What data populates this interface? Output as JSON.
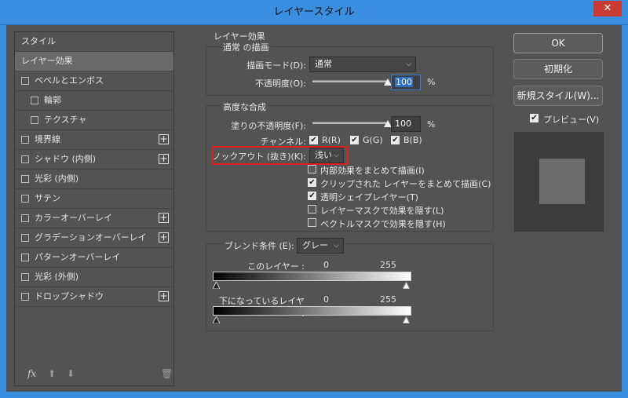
{
  "window": {
    "title": "レイヤースタイル",
    "close_glyph": "✕"
  },
  "style_list": {
    "items": [
      {
        "label": "スタイル",
        "checkbox": false,
        "plus": false,
        "active": false,
        "indent": 0
      },
      {
        "label": "レイヤー効果",
        "checkbox": false,
        "plus": false,
        "active": true,
        "indent": 0
      },
      {
        "label": "ベベルとエンボス",
        "checkbox": true,
        "plus": false,
        "active": false,
        "indent": 0
      },
      {
        "label": "輪郭",
        "checkbox": true,
        "plus": false,
        "active": false,
        "indent": 1
      },
      {
        "label": "テクスチャ",
        "checkbox": true,
        "plus": false,
        "active": false,
        "indent": 1
      },
      {
        "label": "境界線",
        "checkbox": true,
        "plus": true,
        "active": false,
        "indent": 0
      },
      {
        "label": "シャドウ (内側)",
        "checkbox": true,
        "plus": true,
        "active": false,
        "indent": 0
      },
      {
        "label": "光彩 (内側)",
        "checkbox": true,
        "plus": false,
        "active": false,
        "indent": 0
      },
      {
        "label": "サテン",
        "checkbox": true,
        "plus": false,
        "active": false,
        "indent": 0
      },
      {
        "label": "カラーオーバーレイ",
        "checkbox": true,
        "plus": true,
        "active": false,
        "indent": 0
      },
      {
        "label": "グラデーションオーバーレイ",
        "checkbox": true,
        "plus": true,
        "active": false,
        "indent": 0
      },
      {
        "label": "パターンオーバーレイ",
        "checkbox": true,
        "plus": false,
        "active": false,
        "indent": 0
      },
      {
        "label": "光彩 (外側)",
        "checkbox": true,
        "plus": false,
        "active": false,
        "indent": 0
      },
      {
        "label": "ドロップシャドウ",
        "checkbox": true,
        "plus": true,
        "active": false,
        "indent": 0
      }
    ],
    "plus_glyph": "+",
    "bottom_icons": {
      "fx": "fx",
      "up": "⬆",
      "down": "⬇",
      "trash": "🗑"
    }
  },
  "panel": {
    "section_title": "レイヤー効果",
    "normal_group": {
      "title": "通常 の描画",
      "blend_mode_label": "描画モード(D):",
      "blend_mode_value": "通常",
      "opacity_label": "不透明度(O):",
      "opacity_value": "100",
      "opacity_level": 1.0,
      "unit": "%"
    },
    "advanced_group": {
      "title": "高度な合成",
      "fill_opacity_label": "塗りの不透明度(F):",
      "fill_opacity_value": "100",
      "fill_opacity_level": 1.0,
      "unit": "%",
      "channels_label": "チャンネル:",
      "channels": [
        {
          "label": "R(R)",
          "checked": true
        },
        {
          "label": "G(G)",
          "checked": true
        },
        {
          "label": "B(B)",
          "checked": true
        }
      ],
      "knockout_label": "ノックアウト (抜き)(K):",
      "knockout_value": "浅い",
      "options": [
        {
          "label": "内部効果をまとめて描画(I)",
          "checked": false
        },
        {
          "label": "クリップされた レイヤーをまとめて描画(C)",
          "checked": true
        },
        {
          "label": "透明シェイプレイヤー(T)",
          "checked": true
        },
        {
          "label": "レイヤーマスクで効果を隠す(L)",
          "checked": false
        },
        {
          "label": "ベクトルマスクで効果を隠す(H)",
          "checked": false
        }
      ]
    },
    "blend_if": {
      "label": "ブレンド条件 (E):",
      "value": "グレー",
      "this_layer_label": "このレイヤー :",
      "this_layer_min": "0",
      "this_layer_max": "255",
      "underlying_label": "下になっているレイヤー :",
      "underlying_min": "0",
      "underlying_max": "255"
    },
    "chevron": "⌵",
    "check_glyph": "✔"
  },
  "buttons": {
    "ok": "OK",
    "reset": "初期化",
    "new_style": "新規スタイル(W)...",
    "preview_label": "プレビュー(V)",
    "preview_checked": true
  }
}
